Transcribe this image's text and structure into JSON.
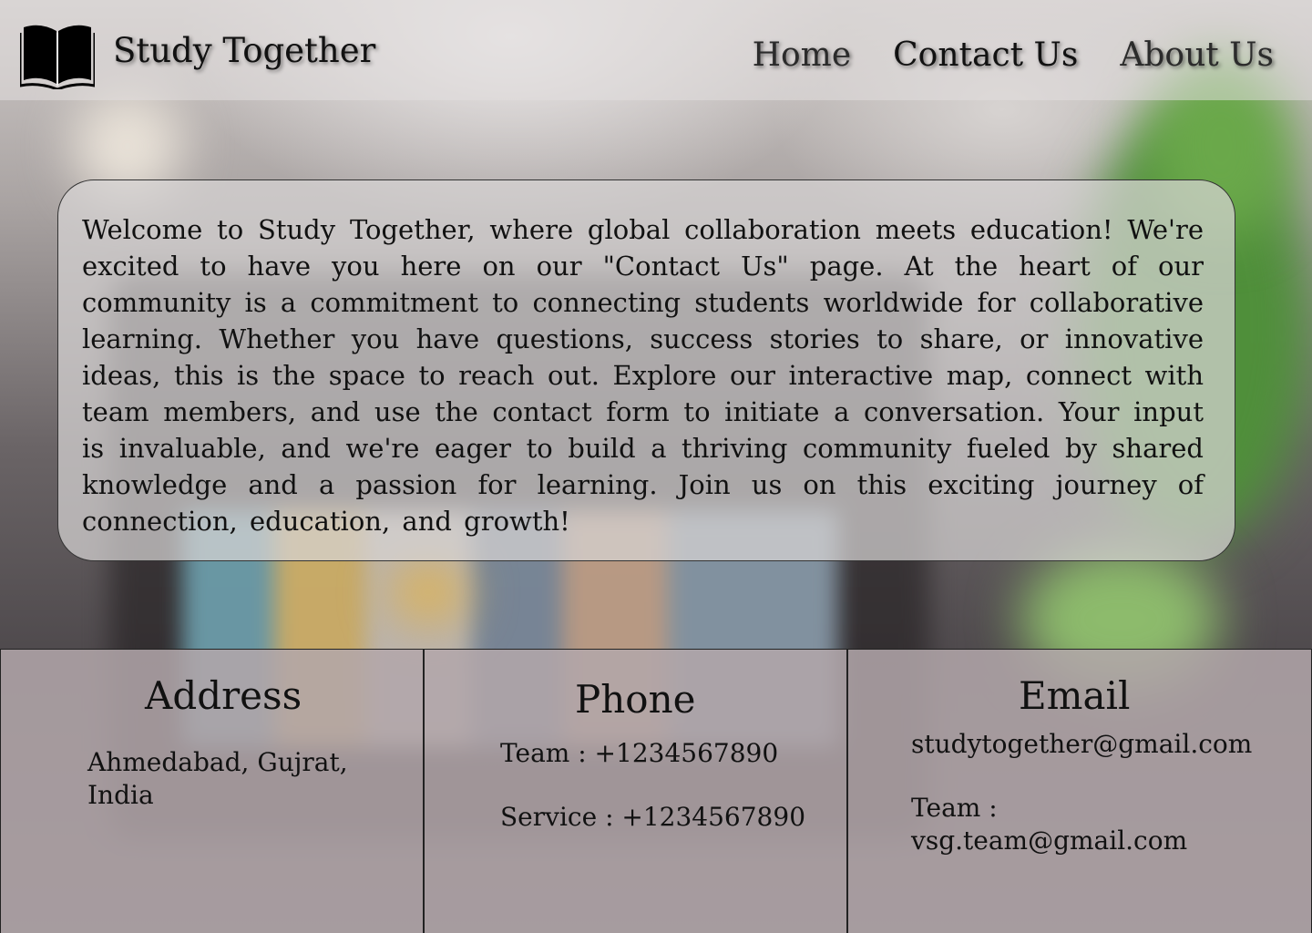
{
  "header": {
    "brand_name": "Study Together",
    "logo_icon": "open-book-icon",
    "nav": [
      "Home",
      "Contact Us",
      "About Us"
    ]
  },
  "intro": {
    "text": "Welcome to Study Together, where global collaboration meets education! We're excited to have you here on our \"Contact Us\" page. At the heart of our community is a commitment to connecting students worldwide for collaborative learning. Whether you have questions, success stories to share, or innovative ideas, this is the space to reach out. Explore our interactive map, connect with team members, and use the contact form to initiate a conversation. Your input is invaluable, and we're eager to build a thriving community fueled by shared knowledge and a passion for learning. Join us on this exciting journey of connection, education, and growth!"
  },
  "contacts": {
    "address": {
      "title": "Address",
      "value": "Ahmedabad, Gujrat, India"
    },
    "phone": {
      "title": "Phone",
      "team": "Team : +1234567890",
      "service": "Service : +1234567890"
    },
    "email": {
      "title": "Email",
      "primary": "studytogether@gmail.com",
      "team": "Team : vsg.team@gmail.com"
    }
  }
}
